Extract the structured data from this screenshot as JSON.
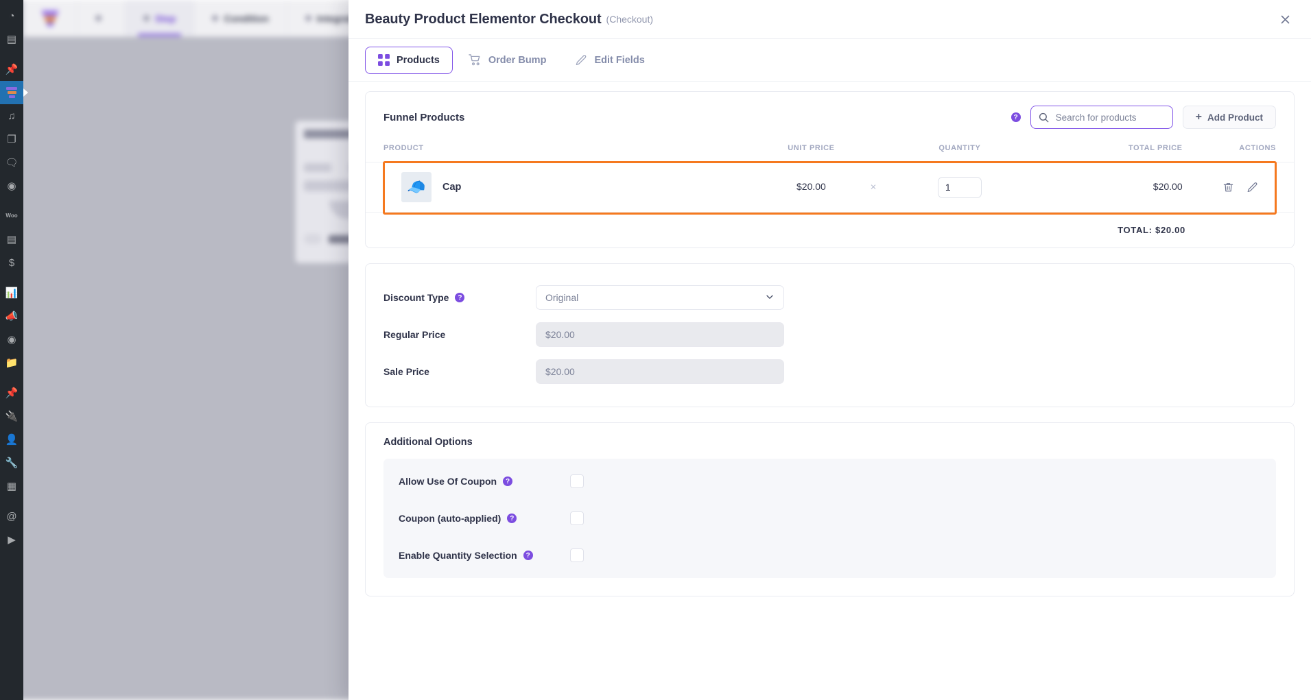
{
  "background": {
    "tabs": [
      {
        "label": "",
        "icon": "funnel-logo",
        "selected": false
      },
      {
        "label": "",
        "icon": "dot",
        "selected": false
      },
      {
        "label": "Step",
        "icon": "dot",
        "selected": true
      },
      {
        "label": "Condition",
        "icon": "dot",
        "selected": false
      },
      {
        "label": "Integrations",
        "icon": "dot",
        "selected": false
      }
    ],
    "card_title": "Landing Page",
    "card_button": "Left to check"
  },
  "wp_sidebar": {
    "items": [
      {
        "name": "dashboard-icon",
        "glyph": "◔"
      },
      {
        "name": "pages-check-icon",
        "glyph": "▤"
      },
      {
        "name": "pin-icon",
        "glyph": "📌"
      },
      {
        "name": "funnel-icon",
        "glyph": "",
        "active": true
      },
      {
        "name": "media-icon",
        "glyph": "♫"
      },
      {
        "name": "copy-pages-icon",
        "glyph": "❐"
      },
      {
        "name": "comments-icon",
        "glyph": "🗨"
      },
      {
        "name": "elementor-icon",
        "glyph": "◉"
      },
      {
        "name": "woocommerce-icon",
        "glyph": "Woo"
      },
      {
        "name": "archive-icon",
        "glyph": "▤"
      },
      {
        "name": "payments-icon",
        "glyph": "$"
      },
      {
        "name": "analytics-icon",
        "glyph": "📊"
      },
      {
        "name": "marketing-icon",
        "glyph": "📣"
      },
      {
        "name": "elementor-circle-icon",
        "glyph": "◉"
      },
      {
        "name": "folder-icon",
        "glyph": "📁"
      },
      {
        "name": "pin2-icon",
        "glyph": "📌"
      },
      {
        "name": "plugins-icon",
        "glyph": "🔌"
      },
      {
        "name": "users-icon",
        "glyph": "👤"
      },
      {
        "name": "tools-icon",
        "glyph": "🔧"
      },
      {
        "name": "settings-grid-icon",
        "glyph": "▦"
      },
      {
        "name": "mail-icon",
        "glyph": "@"
      },
      {
        "name": "play-icon",
        "glyph": "▶"
      }
    ]
  },
  "modal": {
    "title": "Beauty Product Elementor Checkout",
    "subtitle": "(Checkout)",
    "close_label": "✕"
  },
  "tabs": [
    {
      "key": "products",
      "label": "Products",
      "icon": "grid-icon",
      "active": true
    },
    {
      "key": "order_bump",
      "label": "Order Bump",
      "icon": "cart-icon",
      "active": false
    },
    {
      "key": "edit_fields",
      "label": "Edit Fields",
      "icon": "pencil-icon",
      "active": false
    }
  ],
  "funnel_products": {
    "title": "Funnel Products",
    "help": "?",
    "search": {
      "placeholder": "Search for products",
      "value": "",
      "icon": "search-icon"
    },
    "add_product_label": "Add Product",
    "add_product_icon": "plus-icon",
    "columns": [
      "PRODUCT",
      "UNIT PRICE",
      "QUANTITY",
      "TOTAL PRICE",
      "ACTIONS"
    ],
    "rows": [
      {
        "thumb": "🧢",
        "name": "Cap",
        "unit_price": "$20.00",
        "multiplier": "×",
        "quantity": "1",
        "total_price": "$20.00",
        "delete_icon": "trash-icon",
        "edit_icon": "pencil-icon",
        "highlighted": true
      }
    ],
    "total_label": "TOTAL: $20.00"
  },
  "discount": {
    "type_label": "Discount Type",
    "type_value": "Original",
    "type_chevron": "chevron-down-icon",
    "regular_price_label": "Regular Price",
    "regular_price_value": "$20.00",
    "sale_price_label": "Sale Price",
    "sale_price_value": "$20.00"
  },
  "additional_options": {
    "title": "Additional Options",
    "options": [
      {
        "label": "Allow Use Of Coupon",
        "checked": false
      },
      {
        "label": "Coupon (auto-applied)",
        "checked": false
      },
      {
        "label": "Enable Quantity Selection",
        "checked": false
      }
    ]
  },
  "colors": {
    "accent_purple": "#7c4de0",
    "highlight_orange": "#f5791f",
    "text_dark": "#2f3349",
    "muted": "#9096ad"
  }
}
